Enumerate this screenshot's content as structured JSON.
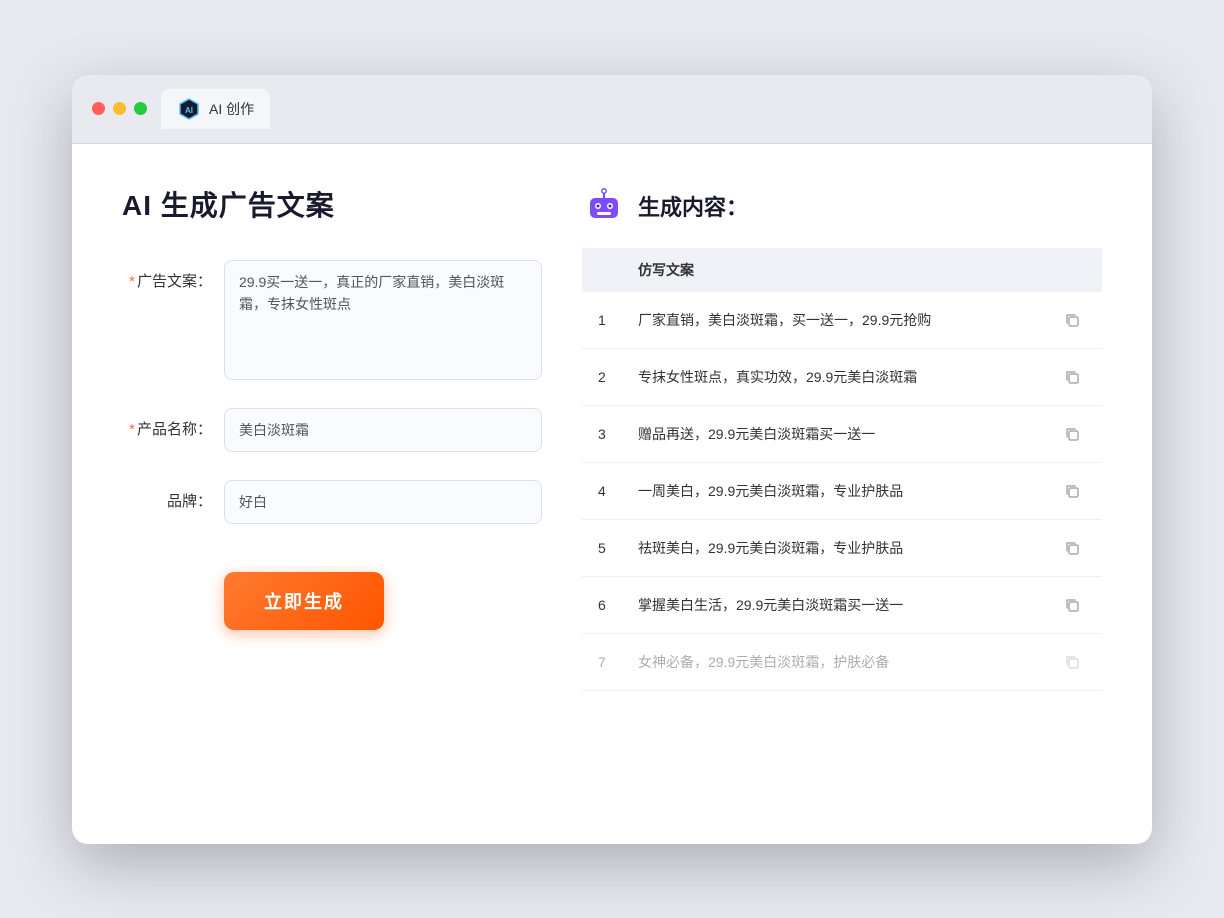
{
  "browser": {
    "tab_label": "AI 创作"
  },
  "page": {
    "title": "AI 生成广告文案",
    "result_title": "生成内容："
  },
  "form": {
    "ad_copy_label": "广告文案：",
    "ad_copy_required": "*",
    "ad_copy_value": "29.9买一送一，真正的厂家直销，美白淡斑霜，专抹女性斑点",
    "product_name_label": "产品名称：",
    "product_name_required": "*",
    "product_name_value": "美白淡斑霜",
    "brand_label": "品牌：",
    "brand_value": "好白",
    "generate_button": "立即生成"
  },
  "results": {
    "column_header": "仿写文案",
    "items": [
      {
        "num": "1",
        "text": "厂家直销，美白淡斑霜，买一送一，29.9元抢购"
      },
      {
        "num": "2",
        "text": "专抹女性斑点，真实功效，29.9元美白淡斑霜"
      },
      {
        "num": "3",
        "text": "赠品再送，29.9元美白淡斑霜买一送一"
      },
      {
        "num": "4",
        "text": "一周美白，29.9元美白淡斑霜，专业护肤品"
      },
      {
        "num": "5",
        "text": "祛斑美白，29.9元美白淡斑霜，专业护肤品"
      },
      {
        "num": "6",
        "text": "掌握美白生活，29.9元美白淡斑霜买一送一"
      },
      {
        "num": "7",
        "text": "女神必备，29.9元美白淡斑霜，护肤必备",
        "faded": true
      }
    ]
  }
}
